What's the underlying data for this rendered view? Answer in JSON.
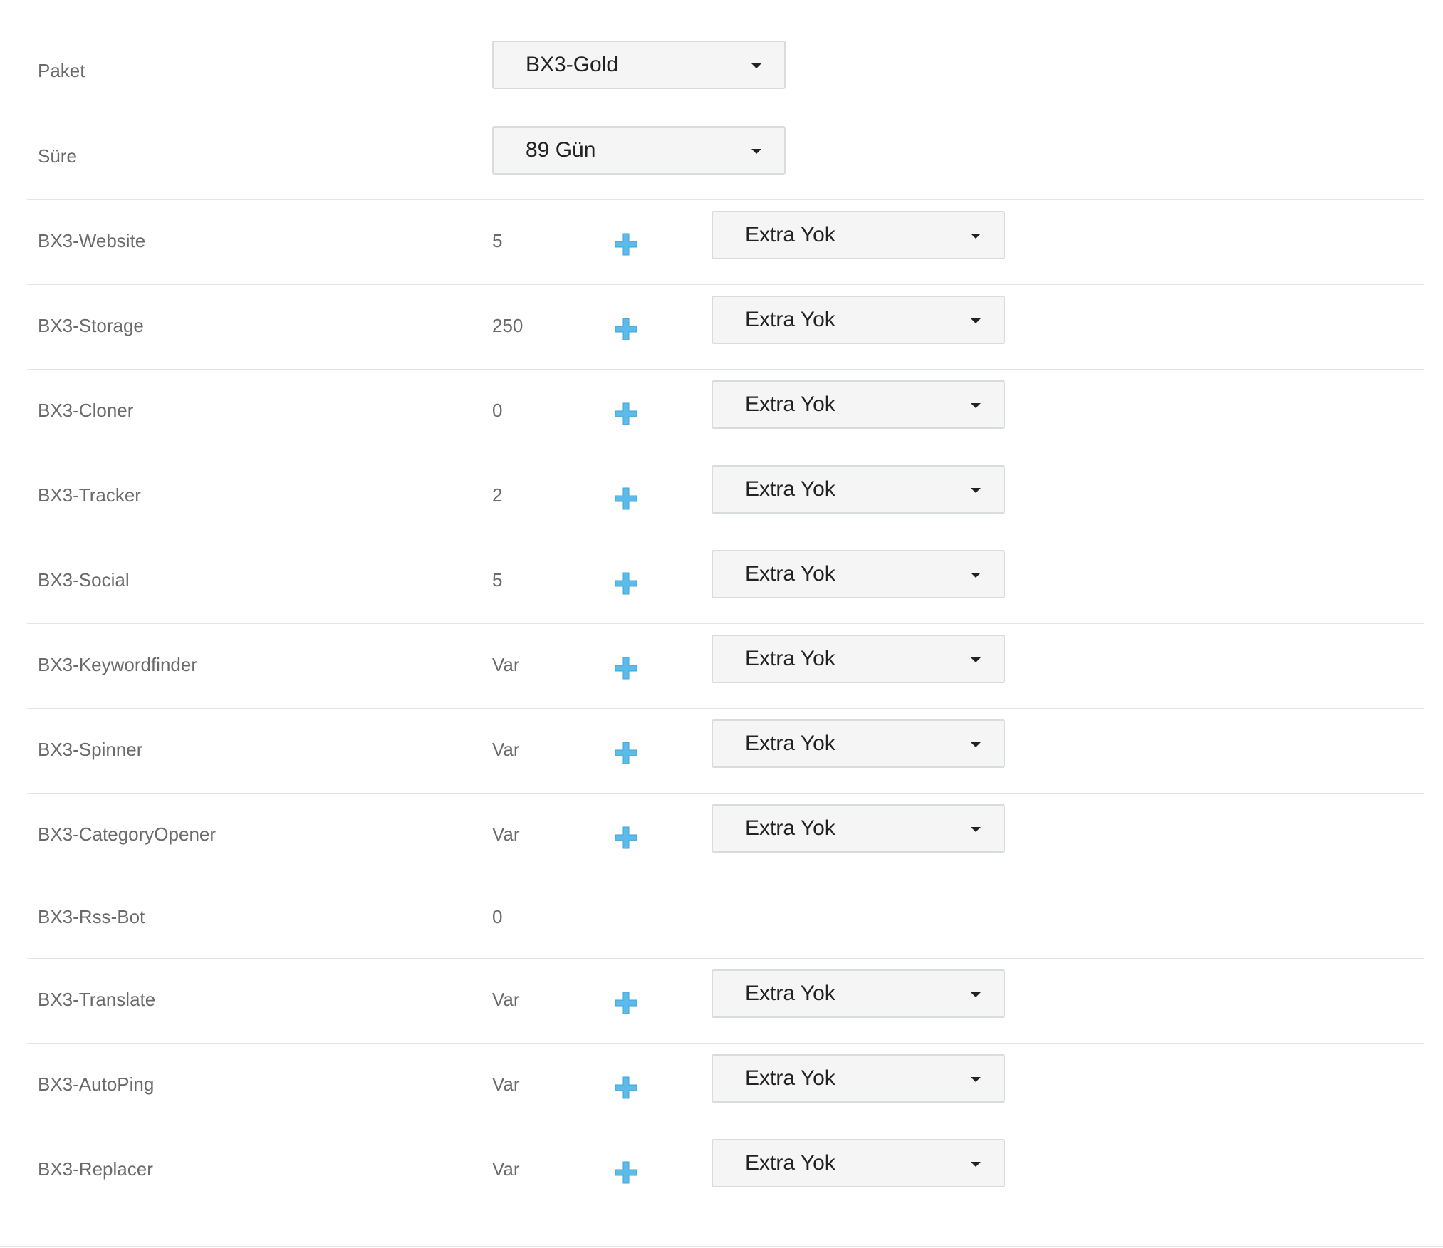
{
  "rows": [
    {
      "label": "Paket",
      "select": "BX3-Gold"
    },
    {
      "label": "Süre",
      "select": "89 Gün"
    },
    {
      "label": "BX3-Website",
      "value": "5",
      "extra": "Extra Yok"
    },
    {
      "label": "BX3-Storage",
      "value": "250",
      "extra": "Extra Yok"
    },
    {
      "label": "BX3-Cloner",
      "value": "0",
      "extra": "Extra Yok"
    },
    {
      "label": "BX3-Tracker",
      "value": "2",
      "extra": "Extra Yok"
    },
    {
      "label": "BX3-Social",
      "value": "5",
      "extra": "Extra Yok"
    },
    {
      "label": "BX3-Keywordfinder",
      "value": "Var",
      "extra": "Extra Yok"
    },
    {
      "label": "BX3-Spinner",
      "value": "Var",
      "extra": "Extra Yok"
    },
    {
      "label": "BX3-CategoryOpener",
      "value": "Var",
      "extra": "Extra Yok"
    },
    {
      "label": "BX3-Rss-Bot",
      "value": "0"
    },
    {
      "label": "BX3-Translate",
      "value": "Var",
      "extra": "Extra Yok"
    },
    {
      "label": "BX3-AutoPing",
      "value": "Var",
      "extra": "Extra Yok"
    },
    {
      "label": "BX3-Replacer",
      "value": "Var",
      "extra": "Extra Yok"
    }
  ],
  "icons": {
    "plus": "plus-icon"
  },
  "colors": {
    "plus_icon": "#5cbbe8",
    "border": "#e4e4e4",
    "select_bg": "#f5f5f5"
  }
}
